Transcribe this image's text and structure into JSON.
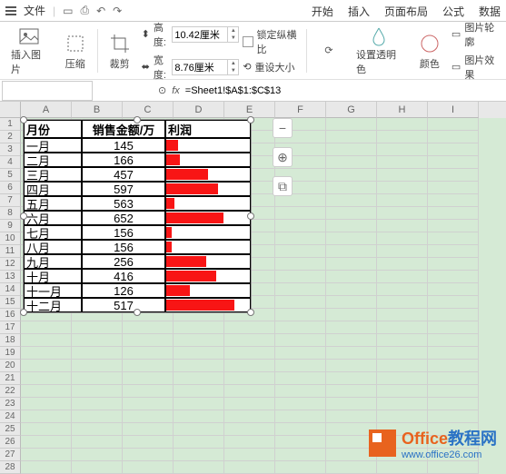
{
  "menubar": {
    "file": "文件"
  },
  "tabbar": {
    "start": "开始",
    "insert": "插入",
    "layout": "页面布局",
    "formula": "公式",
    "data": "数据"
  },
  "ribbon": {
    "insertpic": "插入图片",
    "compress": "压缩",
    "crop": "裁剪",
    "height_lbl": "高度:",
    "height_val": "10.42厘米",
    "width_lbl": "宽度:",
    "width_val": "8.76厘米",
    "lock": "锁定纵横比",
    "reset": "重设大小",
    "trans": "设置透明色",
    "color": "颜色",
    "lununa": "图片轮廓",
    "effect": "图片效果"
  },
  "formula_bar": {
    "formula": "=Sheet1!$A$1:$C$13"
  },
  "cols": [
    "A",
    "B",
    "C",
    "D",
    "E",
    "F",
    "G",
    "H",
    "I"
  ],
  "rows_count": 28,
  "table": {
    "h1": "月份",
    "h2": "销售金额/万",
    "h3": "利润",
    "rows": [
      {
        "m": "一月",
        "v": "145",
        "p": 14
      },
      {
        "m": "二月",
        "v": "166",
        "p": 16
      },
      {
        "m": "三月",
        "v": "457",
        "p": 50
      },
      {
        "m": "四月",
        "v": "597",
        "p": 62
      },
      {
        "m": "五月",
        "v": "563",
        "p": 10
      },
      {
        "m": "六月",
        "v": "652",
        "p": 68
      },
      {
        "m": "七月",
        "v": "156",
        "p": 6
      },
      {
        "m": "八月",
        "v": "156",
        "p": 6
      },
      {
        "m": "九月",
        "v": "256",
        "p": 48
      },
      {
        "m": "十月",
        "v": "416",
        "p": 60
      },
      {
        "m": "十一月",
        "v": "126",
        "p": 28
      },
      {
        "m": "十二月",
        "v": "517",
        "p": 82
      }
    ]
  },
  "watermark": {
    "brand1": "Office",
    "brand2": "教程网",
    "url": "www.office26.com"
  }
}
